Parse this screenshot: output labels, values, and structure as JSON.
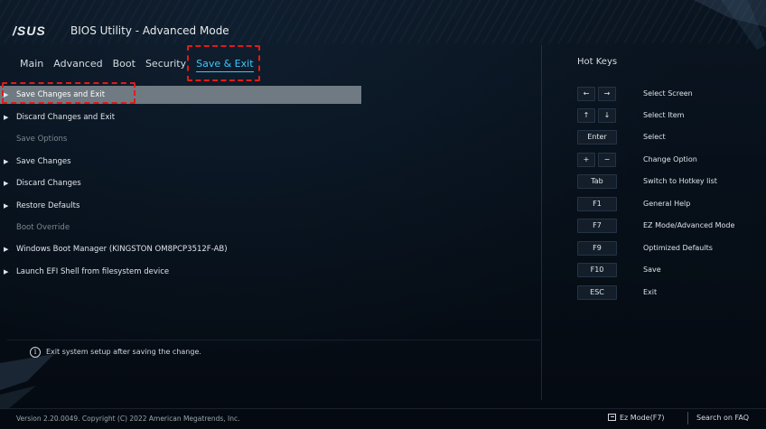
{
  "header": {
    "logo_text": "/SUS",
    "title": "BIOS Utility - Advanced Mode"
  },
  "nav": {
    "tabs": [
      "Main",
      "Advanced",
      "Boot",
      "Security",
      "Save & Exit"
    ],
    "active_tab": "Save & Exit"
  },
  "menu": {
    "items": [
      {
        "label": "Save Changes and Exit",
        "type": "action",
        "selected": true
      },
      {
        "label": "Discard Changes and Exit",
        "type": "action"
      },
      {
        "label": "Save Options",
        "type": "section"
      },
      {
        "label": "Save Changes",
        "type": "action"
      },
      {
        "label": "Discard Changes",
        "type": "action"
      },
      {
        "label": "Restore Defaults",
        "type": "action"
      },
      {
        "label": "Boot Override",
        "type": "section"
      },
      {
        "label": "Windows Boot Manager (KINGSTON OM8PCP3512F-AB)",
        "type": "action"
      },
      {
        "label": "Launch EFI Shell from filesystem device",
        "type": "action"
      }
    ]
  },
  "help": {
    "text": "Exit system setup after saving the change."
  },
  "hotkeys": {
    "title": "Hot Keys",
    "rows": [
      {
        "keys": [
          "←",
          "→"
        ],
        "desc": "Select Screen"
      },
      {
        "keys": [
          "↑",
          "↓"
        ],
        "desc": "Select Item"
      },
      {
        "keys": [
          "Enter"
        ],
        "desc": "Select"
      },
      {
        "keys": [
          "+",
          "−"
        ],
        "desc": "Change Option"
      },
      {
        "keys": [
          "Tab"
        ],
        "desc": "Switch to Hotkey list"
      },
      {
        "keys": [
          "F1"
        ],
        "desc": "General Help"
      },
      {
        "keys": [
          "F7"
        ],
        "desc": "EZ Mode/Advanced Mode"
      },
      {
        "keys": [
          "F9"
        ],
        "desc": "Optimized Defaults"
      },
      {
        "keys": [
          "F10"
        ],
        "desc": "Save"
      },
      {
        "keys": [
          "ESC"
        ],
        "desc": "Exit"
      }
    ]
  },
  "footer": {
    "version": "Version 2.20.0049. Copyright (C) 2022 American Megatrends, Inc.",
    "ez_mode": "Ez Mode(F7)",
    "faq": "Search on FAQ"
  },
  "colors": {
    "accent": "#3ec6ff",
    "selected_bg": "#707a82",
    "annotation_red": "#e21a1a"
  }
}
